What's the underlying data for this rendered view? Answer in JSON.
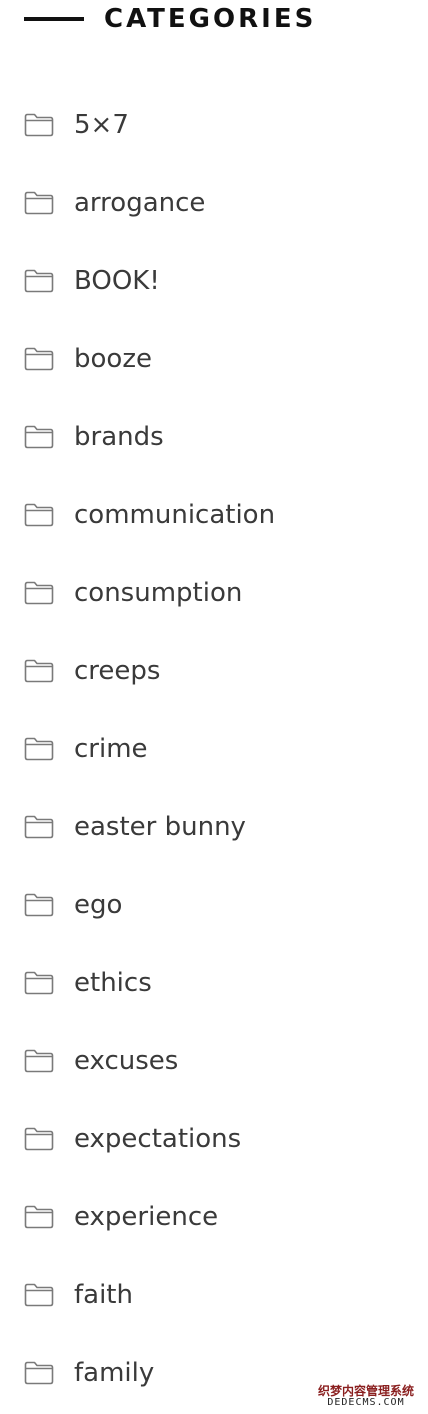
{
  "widget": {
    "title": "CATEGORIES",
    "items": [
      {
        "label": "5×7",
        "icon": "folder-icon"
      },
      {
        "label": "arrogance",
        "icon": "folder-icon"
      },
      {
        "label": "BOOK!",
        "icon": "folder-icon"
      },
      {
        "label": "booze",
        "icon": "folder-icon"
      },
      {
        "label": "brands",
        "icon": "folder-icon"
      },
      {
        "label": "communication",
        "icon": "folder-icon"
      },
      {
        "label": "consumption",
        "icon": "folder-icon"
      },
      {
        "label": "creeps",
        "icon": "folder-icon"
      },
      {
        "label": "crime",
        "icon": "folder-icon"
      },
      {
        "label": "easter bunny",
        "icon": "folder-icon"
      },
      {
        "label": "ego",
        "icon": "folder-icon"
      },
      {
        "label": "ethics",
        "icon": "folder-icon"
      },
      {
        "label": "excuses",
        "icon": "folder-icon"
      },
      {
        "label": "expectations",
        "icon": "folder-icon"
      },
      {
        "label": "experience",
        "icon": "folder-icon"
      },
      {
        "label": "faith",
        "icon": "folder-icon"
      },
      {
        "label": "family",
        "icon": "folder-icon"
      }
    ]
  },
  "watermark": {
    "line1": "织梦内容管理系统",
    "line2": "DEDECMS.COM"
  },
  "colors": {
    "heading": "#111111",
    "text": "#3a3a3a",
    "icon_stroke": "#7a7a7a",
    "background": "#ffffff"
  }
}
